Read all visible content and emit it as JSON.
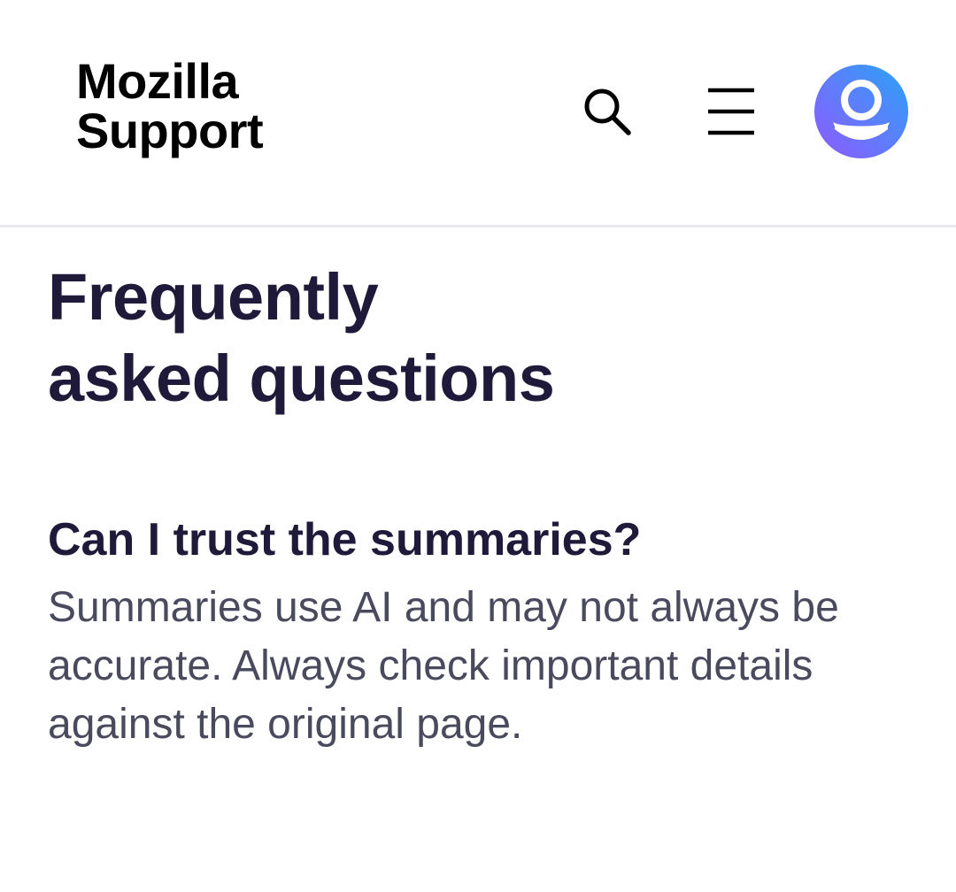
{
  "header": {
    "logo_line1": "Mozilla",
    "logo_line2": "Support",
    "icons": {
      "search": "search-icon",
      "menu": "menu-icon",
      "avatar": "avatar-icon"
    },
    "avatar_gradient": [
      "#2aa3f7",
      "#9059ff"
    ]
  },
  "main": {
    "title_line1": "Frequently",
    "title_line2": "asked questions",
    "faq": [
      {
        "question": "Can I trust the summaries?",
        "answer": "Summaries use AI and may not always be accurate. Always check important details against the original page."
      }
    ]
  },
  "colors": {
    "heading": "#1f1a3a",
    "body_text": "#4a4a5e",
    "divider": "#e8e8ec"
  }
}
